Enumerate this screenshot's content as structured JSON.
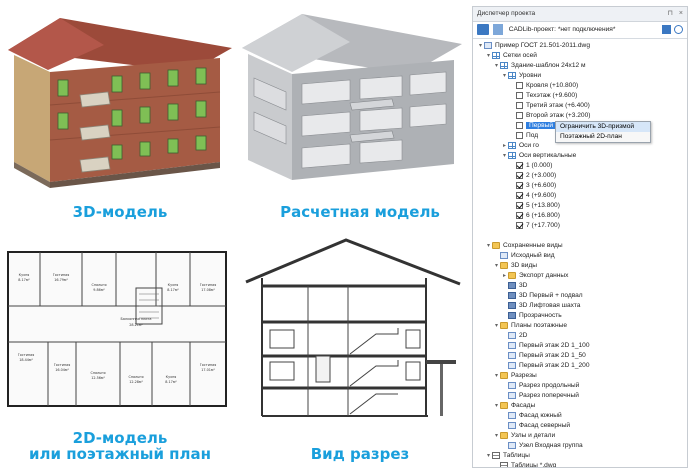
{
  "captions": {
    "model3d": "3D-модель",
    "calc": "Расчетная модель",
    "plan2d_line1": "2D-модель",
    "plan2d_line2": "или поэтажный план",
    "section": "Вид разрез"
  },
  "colors": {
    "caption": "#1a9fdc",
    "selection": "#2f7fe0",
    "roof": "#9c4a3a",
    "brick": "#a55b44",
    "balcony": "#d9d2c2",
    "window": "#7fbf55"
  },
  "pm": {
    "title": "Диспетчер проекта",
    "title_controls": [
      "⊓",
      "×"
    ],
    "project_label": "CADLib-проект: *нет подключения*",
    "tree": [
      {
        "id": "root",
        "depth": 0,
        "text": "Пример ГОСТ 21.501-2011.dwg",
        "icon": "dwg",
        "tw": "▾"
      },
      {
        "id": "grids",
        "depth": 1,
        "text": "Сетки осей",
        "icon": "grid",
        "tw": "▾"
      },
      {
        "id": "bldg",
        "depth": 2,
        "text": "Здание-шаблон 24x12 м",
        "icon": "grid",
        "tw": "▾"
      },
      {
        "id": "levels",
        "depth": 3,
        "text": "Уровни",
        "icon": "grid",
        "tw": "▾"
      },
      {
        "id": "l1",
        "depth": 4,
        "text": "Кровля (+10.800)",
        "cb": "off"
      },
      {
        "id": "l2",
        "depth": 4,
        "text": "Техэтаж (+9.600)",
        "cb": "off"
      },
      {
        "id": "l3",
        "depth": 4,
        "text": "Третий этаж (+6.400)",
        "cb": "off"
      },
      {
        "id": "l4",
        "depth": 4,
        "text": "Второй этаж (+3.200)",
        "cb": "off"
      },
      {
        "id": "l5",
        "depth": 4,
        "text": "Первый этаж (0.000)",
        "cb": "off",
        "selected": true
      },
      {
        "id": "l6",
        "depth": 4,
        "text": "Под",
        "cb": "off"
      },
      {
        "id": "ax1",
        "depth": 3,
        "text": "Оси го",
        "icon": "grid",
        "tw": "▸"
      },
      {
        "id": "ax2",
        "depth": 3,
        "text": "Оси вертикальные",
        "icon": "grid",
        "tw": "▾"
      },
      {
        "id": "v1",
        "depth": 4,
        "text": "1 (0.000)",
        "cb": "on"
      },
      {
        "id": "v2",
        "depth": 4,
        "text": "2 (+3.000)",
        "cb": "on"
      },
      {
        "id": "v3",
        "depth": 4,
        "text": "3 (+6.600)",
        "cb": "on"
      },
      {
        "id": "v4",
        "depth": 4,
        "text": "4 (+9.600)",
        "cb": "on"
      },
      {
        "id": "v5",
        "depth": 4,
        "text": "5 (+13.800)",
        "cb": "on"
      },
      {
        "id": "v6",
        "depth": 4,
        "text": "6 (+16.800)",
        "cb": "on"
      },
      {
        "id": "v7",
        "depth": 4,
        "text": "7 (+17.700)",
        "cb": "on"
      },
      {
        "id": "gap1",
        "depth": 0,
        "text": ""
      },
      {
        "id": "saved",
        "depth": 1,
        "text": "Сохраненные виды",
        "icon": "folder",
        "tw": "▾"
      },
      {
        "id": "orig",
        "depth": 2,
        "text": "Исходный вид",
        "icon": "view"
      },
      {
        "id": "v3d",
        "depth": 2,
        "text": "3D виды",
        "icon": "folder",
        "tw": "▾"
      },
      {
        "id": "exp",
        "depth": 3,
        "text": "Экспорт данных",
        "icon": "folder",
        "tw": "▸"
      },
      {
        "id": "d3d",
        "depth": 3,
        "text": "3D",
        "icon": "cube"
      },
      {
        "id": "d3d1",
        "depth": 3,
        "text": "3D Первый + подвал",
        "icon": "cube"
      },
      {
        "id": "d3d2",
        "depth": 3,
        "text": "3D Лифтовая шахта",
        "icon": "cube"
      },
      {
        "id": "trans",
        "depth": 3,
        "text": "Прозрачность",
        "icon": "cube"
      },
      {
        "id": "plans",
        "depth": 2,
        "text": "Планы поэтажные",
        "icon": "folder",
        "tw": "▾"
      },
      {
        "id": "p2d",
        "depth": 3,
        "text": "2D",
        "icon": "view"
      },
      {
        "id": "p100",
        "depth": 3,
        "text": "Первый этаж 2D 1_100",
        "icon": "view"
      },
      {
        "id": "p50",
        "depth": 3,
        "text": "Первый этаж 2D 1_50",
        "icon": "view"
      },
      {
        "id": "p200",
        "depth": 3,
        "text": "Первый этаж 2D 1_200",
        "icon": "view"
      },
      {
        "id": "cuts",
        "depth": 2,
        "text": "Разрезы",
        "icon": "folder",
        "tw": "▾"
      },
      {
        "id": "c1",
        "depth": 3,
        "text": "Разрез продольный",
        "icon": "view"
      },
      {
        "id": "c2",
        "depth": 3,
        "text": "Разрез поперечный",
        "icon": "view"
      },
      {
        "id": "fac",
        "depth": 2,
        "text": "Фасады",
        "icon": "folder",
        "tw": "▾"
      },
      {
        "id": "f1",
        "depth": 3,
        "text": "Фасад южный",
        "icon": "view"
      },
      {
        "id": "f2",
        "depth": 3,
        "text": "Фасад северный",
        "icon": "view"
      },
      {
        "id": "nodes",
        "depth": 2,
        "text": "Узлы и детали",
        "icon": "folder",
        "tw": "▾"
      },
      {
        "id": "n1",
        "depth": 3,
        "text": "Узел Входная группа",
        "icon": "view"
      },
      {
        "id": "tabs",
        "depth": 1,
        "text": "Таблицы",
        "icon": "table",
        "tw": "▾"
      },
      {
        "id": "t1",
        "depth": 2,
        "text": "Таблицы *.dwg",
        "icon": "table"
      }
    ],
    "context_menu": [
      "Ограничить 3D-призмой",
      "Поэтажный 2D-план"
    ]
  },
  "plan_rooms": [
    {
      "name": "Кухня",
      "area": "8.17м²"
    },
    {
      "name": "Гостиная",
      "area": "16.79м²"
    },
    {
      "name": "Спальня",
      "area": "9.86м²"
    },
    {
      "name": "Кухня",
      "area": "8.17м²"
    },
    {
      "name": "Гостиная",
      "area": "17.08м²"
    },
    {
      "name": "Балконная плита",
      "area": "28.21м²"
    },
    {
      "name": "Гостиная",
      "area": "18.44м²"
    },
    {
      "name": "Гостиная",
      "area": "16.04м²"
    },
    {
      "name": "Спальня",
      "area": "12.56м²"
    },
    {
      "name": "Спальня",
      "area": "12.28м²"
    },
    {
      "name": "Кухня",
      "area": "8.17м²"
    },
    {
      "name": "Гостиная",
      "area": "17.01м²"
    }
  ]
}
